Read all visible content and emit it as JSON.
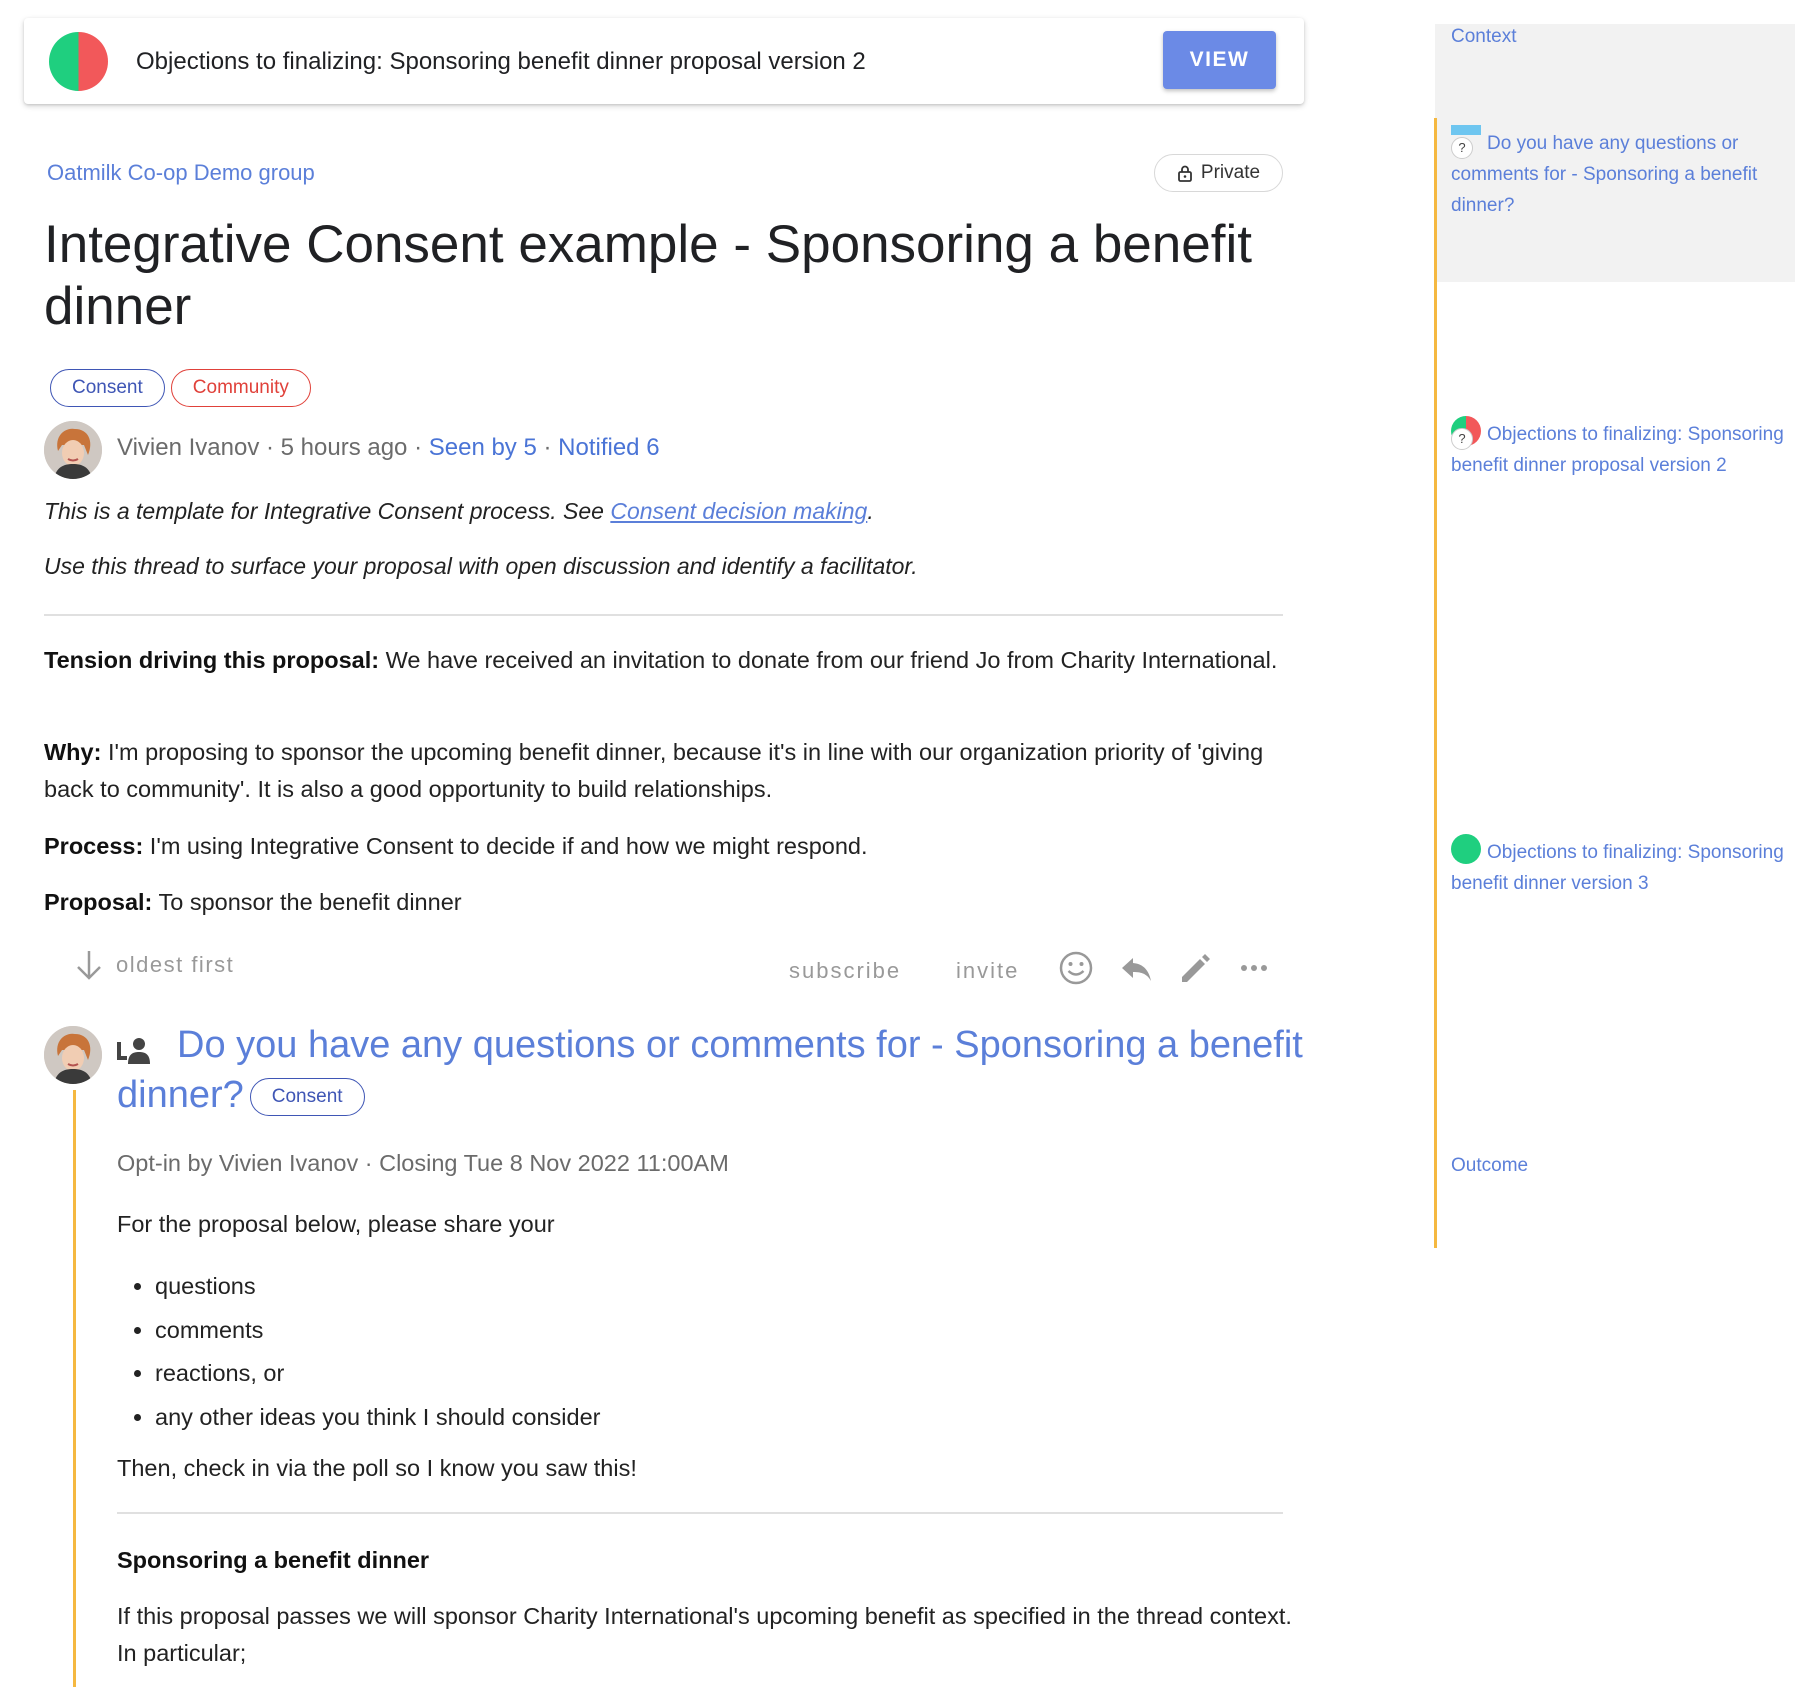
{
  "banner": {
    "text": "Objections to finalizing: Sponsoring benefit dinner proposal version 2",
    "button": "VIEW",
    "pie_colors": [
      "#1fcf7f",
      "#f2585a"
    ]
  },
  "discussion": {
    "group": "Oatmilk Co-op Demo group",
    "privacy": "Private",
    "title": "Integrative Consent example - Sponsoring a benefit dinner",
    "tags": [
      "Consent",
      "Community"
    ],
    "author": "Vivien Ivanov",
    "sep1": " · ",
    "time": "5 hours ago",
    "sep2": " · ",
    "seen": "Seen by 5",
    "sep3": " · ",
    "notified": "Notified 6",
    "intro1_text": "This is a template for Integrative Consent process. See ",
    "intro1_link": "Consent decision making",
    "intro1_end": ".",
    "intro2": "Use this thread to surface your proposal with open discussion and identify a facilitator.",
    "tension_label": "Tension driving this proposal:",
    "tension_text": " We have received an invitation to donate from our friend Jo from Charity International.",
    "why_label": "Why:",
    "why_text": " I'm proposing to sponsor the upcoming benefit dinner, because it's in line with our organization priority of 'giving back to community'. It is also a good opportunity to build relationships.",
    "process_label": "Process:",
    "process_text": " I'm using Integrative Consent to decide if and how we might respond.",
    "proposal_label": "Proposal:",
    "proposal_text": " To sponsor the benefit dinner"
  },
  "actions": {
    "sort": "oldest first",
    "subscribe": "subscribe",
    "invite": "invite"
  },
  "poll": {
    "title": "Do you have any questions or comments for - Sponsoring a benefit dinner?",
    "tag": "Consent",
    "meta": "Opt-in by Vivien Ivanov · Closing Tue 8 Nov 2022 11:00AM",
    "lead": "For the proposal below, please share your",
    "bullets": [
      "questions",
      "comments",
      "reactions, or",
      "any other ideas you think I should consider"
    ],
    "checkin": "Then, check in via the poll so I know you saw this!",
    "section_title": "Sponsoring a benefit dinner",
    "section_text": "If this proposal passes we will sponsor Charity International's upcoming benefit as specified in the thread context. In particular;"
  },
  "sidebar": {
    "context": "Context",
    "items": [
      "Do you have any questions or comments for - Sponsoring a benefit dinner?",
      "Objections to finalizing: Sponsoring benefit dinner proposal version 2",
      "Objections to finalizing: Sponsoring benefit dinner version 3"
    ],
    "qmark": "?",
    "outcome": "Outcome"
  },
  "colors": {
    "accent": "#5b7fd9",
    "thread_line": "#f5b840",
    "consent_tag": "#3f56b5",
    "community_tag": "#e0413a"
  }
}
